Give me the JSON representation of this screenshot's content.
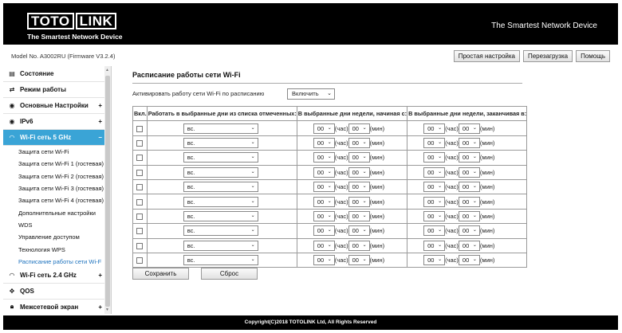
{
  "header": {
    "logo_left": "TOTO",
    "logo_right": "LINK",
    "logo_tagline": "The Smartest Network Device",
    "slogan": "The Smartest Network Device"
  },
  "topbar": {
    "model": "Model No. A3002RU (Firmware V3.2.4)",
    "buttons": [
      "Простая настройка",
      "Перезагрузка",
      "Помощь"
    ]
  },
  "sidebar": {
    "items": [
      {
        "label": "Состояние",
        "icon": "status-icon",
        "expand": ""
      },
      {
        "label": "Режим работы",
        "icon": "mode-icon",
        "expand": ""
      },
      {
        "label": "Основные Настройки",
        "icon": "globe-icon",
        "expand": "+"
      },
      {
        "label": "IPv6",
        "icon": "globe-icon",
        "expand": "+"
      },
      {
        "label": "Wi-Fi сеть 5 GHz",
        "icon": "wifi-icon",
        "expand": "–"
      }
    ],
    "subitems": [
      "Защита сети Wi-Fi",
      "Защита сети Wi-Fi 1 (гостевая)",
      "Защита сети Wi-Fi 2 (гостевая)",
      "Защита сети Wi-Fi 3 (гостевая)",
      "Защита сети Wi-Fi 4 (гостевая)",
      "Дополнительные настройки",
      "WDS",
      "Управление доступом",
      "Технология WPS",
      "Расписание работы сети Wi-F"
    ],
    "items_after": [
      {
        "label": "Wi-Fi сеть 2.4 GHz",
        "icon": "wifi-icon",
        "expand": "+"
      },
      {
        "label": "QOS",
        "icon": "qos-icon",
        "expand": ""
      },
      {
        "label": "Межсетевой экран",
        "icon": "lock-icon",
        "expand": "+"
      }
    ],
    "active_color": "#3aa4d6"
  },
  "main": {
    "title": "Расписание работы сети Wi-Fi",
    "activate_label": "Активировать работу сети Wi-Fi по расписанию",
    "activate_value": "Включить",
    "columns": [
      "Вкл.",
      "Работать в выбранные дни из списка отмеченных:",
      "В выбранные дни недели, начиная с:",
      "В выбранные дни недели, заканчивая в:"
    ],
    "day_value": "вс.",
    "hour_value": "00",
    "min_value": "00",
    "hour_unit": "(час)",
    "min_unit": "(мин)",
    "row_count": 10,
    "save_label": "Сохранить",
    "reset_label": "Сброс"
  },
  "footer": {
    "copyright": "Copyright(C)2018 TOTOLINK Ltd, All Rights Reserved"
  }
}
